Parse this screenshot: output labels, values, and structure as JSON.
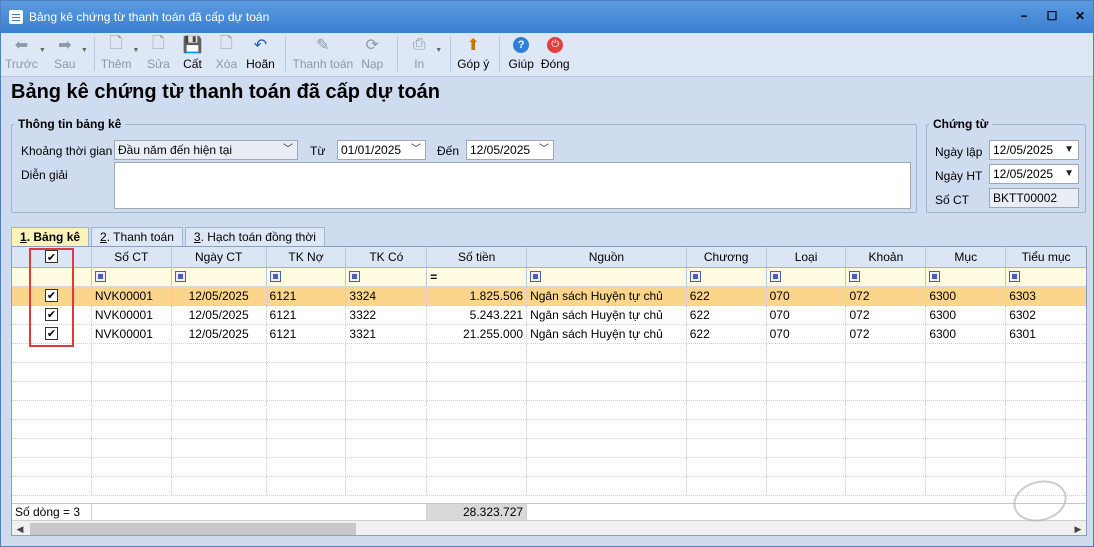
{
  "window": {
    "title": "Bảng kê chứng từ thanh toán đã cấp dự toán"
  },
  "toolbar": {
    "items": [
      {
        "label": "Trước",
        "icon": "arrow-left-icon",
        "disabled": true
      },
      {
        "label": "Sau",
        "icon": "arrow-right-icon",
        "disabled": true
      },
      {
        "label": "Thêm",
        "icon": "new-document-icon",
        "disabled": true
      },
      {
        "label": "Sửa",
        "icon": "edit-document-icon",
        "disabled": true
      },
      {
        "label": "Cất",
        "icon": "save-icon",
        "disabled": false
      },
      {
        "label": "Xóa",
        "icon": "delete-document-icon",
        "disabled": true
      },
      {
        "label": "Hoãn",
        "icon": "undo-icon",
        "disabled": false
      },
      {
        "label": "Thanh toán",
        "icon": "pen-icon",
        "disabled": true
      },
      {
        "label": "Nạp",
        "icon": "refresh-icon",
        "disabled": true
      },
      {
        "label": "In",
        "icon": "printer-icon",
        "disabled": true
      },
      {
        "label": "Góp ý",
        "icon": "feedback-icon",
        "disabled": false
      },
      {
        "label": "Giúp",
        "icon": "help-icon",
        "disabled": false
      },
      {
        "label": "Đóng",
        "icon": "power-icon",
        "disabled": false
      }
    ]
  },
  "page": {
    "heading": "Bảng kê chứng từ thanh toán đã cấp dự toán"
  },
  "info": {
    "legend": "Thông tin bảng kê",
    "period_label": "Khoảng thời gian",
    "period_value": "Đầu năm đến hiện tại",
    "from_label": "Từ",
    "from_value": "01/01/2025",
    "to_label": "Đến",
    "to_value": "12/05/2025",
    "desc_label": "Diễn giải",
    "desc_value": ""
  },
  "voucher": {
    "legend": "Chứng từ",
    "date_label": "Ngày lập",
    "date_value": "12/05/2025",
    "posting_label": "Ngày HT",
    "posting_value": "12/05/2025",
    "number_label": "Số CT",
    "number_value": "BKTT00002"
  },
  "tabs": [
    {
      "num": "1",
      "label": ". Bảng kê"
    },
    {
      "num": "2",
      "label": ". Thanh toán"
    },
    {
      "num": "3",
      "label": ". Hạch toán đồng thời"
    }
  ],
  "grid": {
    "columns": [
      "",
      "Số CT",
      "Ngày CT",
      "TK Nợ",
      "TK Có",
      "Số tiền",
      "Nguồn",
      "Chương",
      "Loại",
      "Khoản",
      "Mục",
      "Tiểu mục"
    ],
    "rows": [
      {
        "checked": true,
        "so_ct": "NVK00001",
        "ngay_ct": "12/05/2025",
        "tk_no": "6121",
        "tk_co": "3324",
        "so_tien": "1.825.506",
        "nguon": "Ngân sách Huyện tự chủ",
        "chuong": "622",
        "loai": "070",
        "khoan": "072",
        "muc": "6300",
        "tieu_muc": "6303"
      },
      {
        "checked": true,
        "so_ct": "NVK00001",
        "ngay_ct": "12/05/2025",
        "tk_no": "6121",
        "tk_co": "3322",
        "so_tien": "5.243.221",
        "nguon": "Ngân sách Huyện tự chủ",
        "chuong": "622",
        "loai": "070",
        "khoan": "072",
        "muc": "6300",
        "tieu_muc": "6302"
      },
      {
        "checked": true,
        "so_ct": "NVK00001",
        "ngay_ct": "12/05/2025",
        "tk_no": "6121",
        "tk_co": "3321",
        "so_tien": "21.255.000",
        "nguon": "Ngân sách Huyện tự chủ",
        "chuong": "622",
        "loai": "070",
        "khoan": "072",
        "muc": "6300",
        "tieu_muc": "6301"
      }
    ],
    "footer": {
      "count_label": "Số dòng = 3",
      "total": "28.323.727"
    }
  }
}
